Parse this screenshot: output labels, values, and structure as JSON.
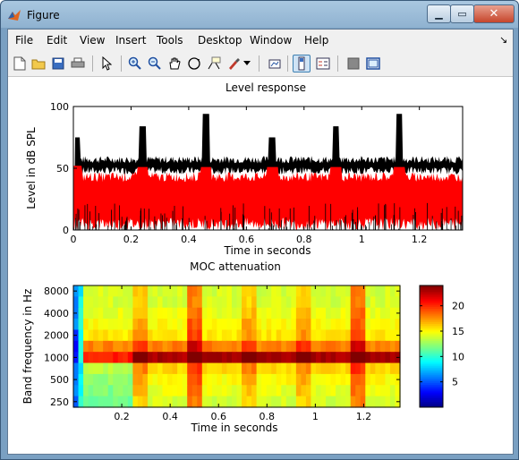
{
  "window": {
    "title": "Figure"
  },
  "menu": [
    "File",
    "Edit",
    "View",
    "Insert",
    "Tools",
    "Desktop",
    "Window",
    "Help"
  ],
  "toolbar_icons": [
    "new-figure-icon",
    "open-file-icon",
    "save-icon",
    "print-icon",
    "pointer-icon",
    "zoom-in-icon",
    "zoom-out-icon",
    "pan-icon",
    "rotate-3d-icon",
    "data-cursor-icon",
    "brush-icon",
    "brush-dropdown-icon",
    "link-plot-icon",
    "colorbar-icon",
    "legend-icon",
    "hide-plot-tools-icon",
    "show-plot-tools-icon"
  ],
  "colors": {
    "black_trace": "#000000",
    "red_trace": "#ff0000"
  },
  "chart_data": [
    {
      "type": "line",
      "title": "Level response",
      "xlabel": "Time in seconds",
      "ylabel": "Level in dB SPL",
      "xlim": [
        0,
        1.35
      ],
      "ylim": [
        0,
        100
      ],
      "xticks": [
        "0",
        "0.2",
        "0.4",
        "0.6",
        "0.8",
        "1",
        "1.2"
      ],
      "yticks": [
        "0",
        "50",
        "100"
      ],
      "series": [
        {
          "color": "#000000",
          "baseline_level": 57,
          "peaks": [
            {
              "t": 0.01,
              "level": 75
            },
            {
              "t": 0.24,
              "level": 84
            },
            {
              "t": 0.46,
              "level": 94
            },
            {
              "t": 0.69,
              "level": 75
            },
            {
              "t": 0.91,
              "level": 84
            },
            {
              "t": 1.13,
              "level": 94
            }
          ]
        },
        {
          "color": "#ff0000",
          "baseline_level": 43
        }
      ]
    },
    {
      "type": "heatmap",
      "title": "MOC attenuation",
      "xlabel": "Time in seconds",
      "ylabel": "Band frequency in Hz",
      "xlim": [
        0,
        1.35
      ],
      "xticks": [
        "0.2",
        "0.4",
        "0.6",
        "0.8",
        "1",
        "1.2"
      ],
      "yticks": [
        "8000",
        "4000",
        "2000",
        "1000",
        "500",
        "250"
      ],
      "rows": [
        "8000",
        "5657",
        "4000",
        "2828",
        "2000",
        "1414",
        "1000",
        "707",
        "500",
        "354",
        "250"
      ],
      "colorbar": {
        "min": 0,
        "max": 24,
        "ticks": [
          "5",
          "10",
          "15",
          "20"
        ]
      }
    }
  ]
}
